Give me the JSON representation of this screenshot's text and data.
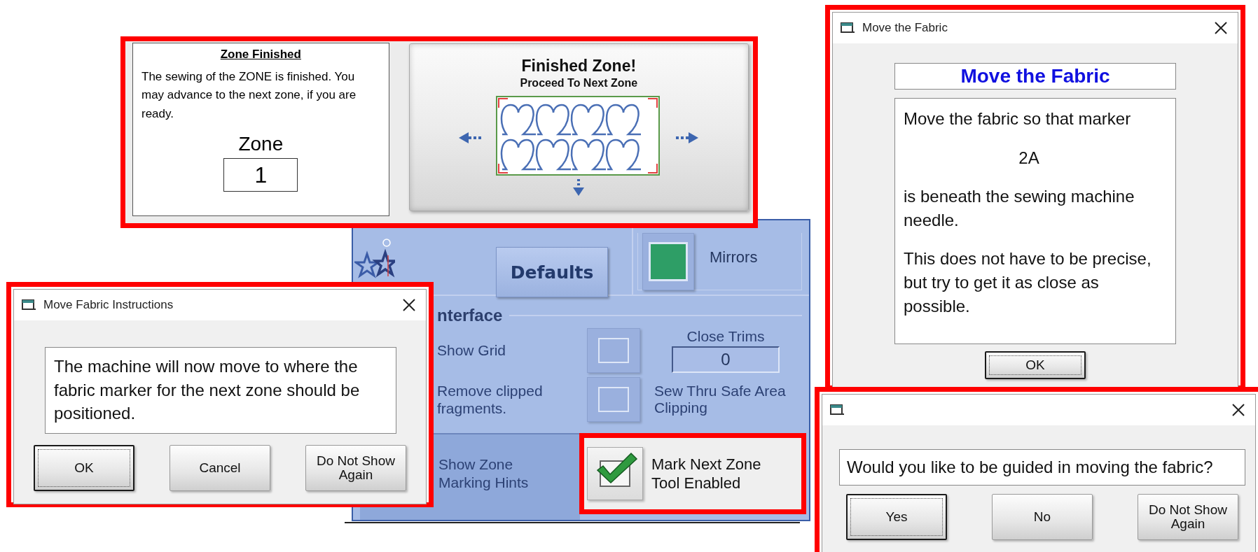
{
  "zone_finished_panel": {
    "heading": "Zone Finished",
    "message": "The sewing of the ZONE is finished. You may advance to the next zone, if you are ready.",
    "zone_label": "Zone",
    "zone_value": "1",
    "finish_button": {
      "title": "Finished Zone!",
      "subtitle": "Proceed To Next Zone"
    }
  },
  "settings_panel": {
    "defaults_button": "Defaults",
    "mirrors": {
      "label": "Mirrors",
      "checked": true
    },
    "section_title": "nterface",
    "grid_rows": [
      {
        "label": "Show Grid",
        "checked": false,
        "side": {
          "kind": "field",
          "label": "Close Trims",
          "value": "0"
        }
      },
      {
        "label": "Remove clipped fragments.",
        "checked": false,
        "side": {
          "kind": "text",
          "label": "Sew Thru Safe Area Clipping"
        }
      }
    ],
    "zone_hints_label": "Show Zone Marking Hints"
  },
  "mark_next_zone": {
    "label": "Mark Next Zone Tool Enabled",
    "checked": true
  },
  "instructions_dialog": {
    "title": "Move Fabric Instructions",
    "message": "The machine will now move to where the fabric marker for the next zone should be positioned.",
    "buttons": [
      {
        "label": "OK",
        "default": true
      },
      {
        "label": "Cancel",
        "default": false
      },
      {
        "label": "Do Not Show Again",
        "default": false
      }
    ]
  },
  "move_fabric_dialog": {
    "title": "Move the Fabric",
    "heading": "Move the Fabric",
    "paragraphs": [
      {
        "kind": "text",
        "text": "Move the fabric so that marker"
      },
      {
        "kind": "marker",
        "text": "2A"
      },
      {
        "kind": "text",
        "text": "is beneath the sewing machine needle."
      },
      {
        "kind": "text",
        "text": "This does not have to be precise, but try to get it as close as possible."
      }
    ],
    "buttons": [
      {
        "label": "OK",
        "default": true
      }
    ]
  },
  "guide_dialog": {
    "message": "Would you like to be guided in moving the fabric?",
    "buttons": [
      {
        "label": "Yes",
        "default": true
      },
      {
        "label": "No",
        "default": false
      },
      {
        "label": "Do Not Show Again",
        "default": false
      }
    ]
  }
}
